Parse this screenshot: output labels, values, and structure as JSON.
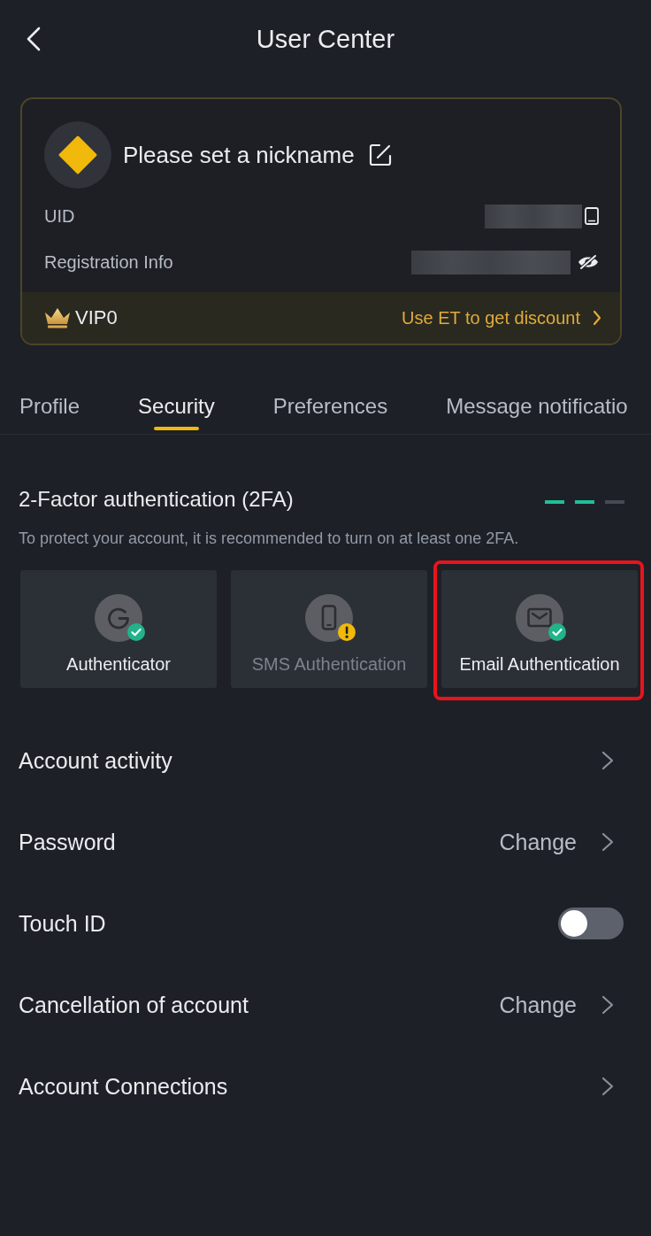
{
  "header": {
    "title": "User Center"
  },
  "profile": {
    "nickname": "Please set a nickname",
    "fields": [
      {
        "label": "UID",
        "kind": "copy"
      },
      {
        "label": "Registration Info",
        "kind": "hidden"
      }
    ],
    "vip": {
      "label": "VIP0",
      "promo": "Use ET to get discount"
    }
  },
  "tabs": [
    {
      "label": "Profile",
      "selected": false
    },
    {
      "label": "Security",
      "selected": true
    },
    {
      "label": "Preferences",
      "selected": false
    },
    {
      "label": "Message notificatio",
      "selected": false
    }
  ],
  "two_factor": {
    "title": "2-Factor authentication (2FA)",
    "level": 0.667,
    "hint": "To protect your account, it is recommended to turn on at least one 2FA.",
    "methods": [
      {
        "label": "Authenticator",
        "kind": "authenticator",
        "enabled": true,
        "highlighted": false
      },
      {
        "label": "SMS Authentication",
        "kind": "sms",
        "enabled": false,
        "highlighted": false
      },
      {
        "label": "Email Authentication",
        "kind": "email",
        "enabled": true,
        "highlighted": true
      }
    ]
  },
  "rows": [
    {
      "label": "Account activity",
      "kind": "link"
    },
    {
      "label": "Password",
      "kind": "link",
      "value": "Change"
    },
    {
      "label": "Touch ID",
      "kind": "toggle",
      "on": false
    },
    {
      "label": "Cancellation of account",
      "kind": "link",
      "value": "Change"
    },
    {
      "label": "Account Connections",
      "kind": "link"
    }
  ]
}
